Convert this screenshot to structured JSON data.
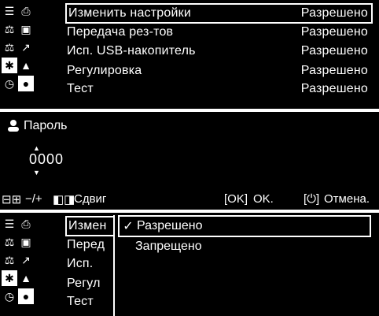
{
  "menu": {
    "icons_col1": [
      "menu-icon",
      "balance-icon",
      "balance-settings-icon",
      "gear-icon",
      "display-settings-icon"
    ],
    "icons_col2": [
      "print-icon",
      "save-icon",
      "chart-icon",
      "weight-icon",
      "user-icon"
    ],
    "rows": [
      {
        "label": "Изменить настройки",
        "value": "Разрешено",
        "selected": true
      },
      {
        "label": "Передача рез-тов",
        "value": "Разрешено",
        "selected": false
      },
      {
        "label": "Исп. USB-накопитель",
        "value": "Разрешено",
        "selected": false
      },
      {
        "label": "Регулировка",
        "value": "Разрешено",
        "selected": false
      },
      {
        "label": "Тест",
        "value": "Разрешено",
        "selected": false
      }
    ]
  },
  "password": {
    "title": "Пароль",
    "value": "0000",
    "hints": {
      "adjust": "−/+",
      "shift": "Сдвиг",
      "ok_key": "[OK]",
      "ok": "OK.",
      "cancel": "Отмена."
    }
  },
  "dropdown": {
    "truncated_labels": [
      "Измен",
      "Перед",
      "Исп.",
      "Регул",
      "Тест"
    ],
    "options": [
      {
        "label": "Разрешено",
        "checked": true
      },
      {
        "label": "Запрещено",
        "checked": false
      }
    ]
  }
}
